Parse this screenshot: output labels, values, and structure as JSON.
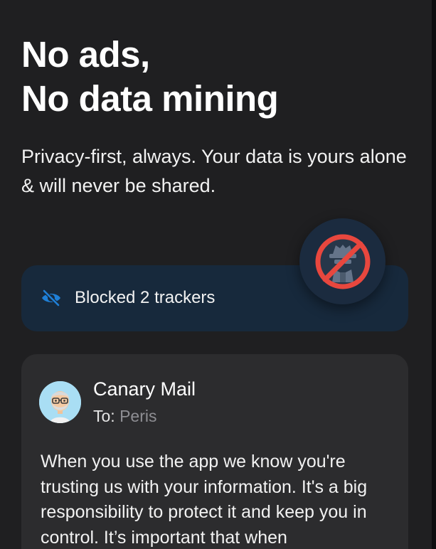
{
  "headline": {
    "line1": "No ads,",
    "line2": "No data mining"
  },
  "subtitle": "Privacy-first, always. Your data is yours alone & will never be shared.",
  "tracker": {
    "text": "Blocked 2 trackers",
    "icon": "eye-slash-icon",
    "accent": "#1f7fd6"
  },
  "badge": {
    "icon": "no-spy-icon",
    "color": "#e8473e"
  },
  "mail": {
    "sender": "Canary Mail",
    "to_label": "To:",
    "to_name": "Peris",
    "body": "When you use the app we know you're trusting us with your information. It's a big responsibility to protect it and keep you in control. It’s important that when"
  }
}
